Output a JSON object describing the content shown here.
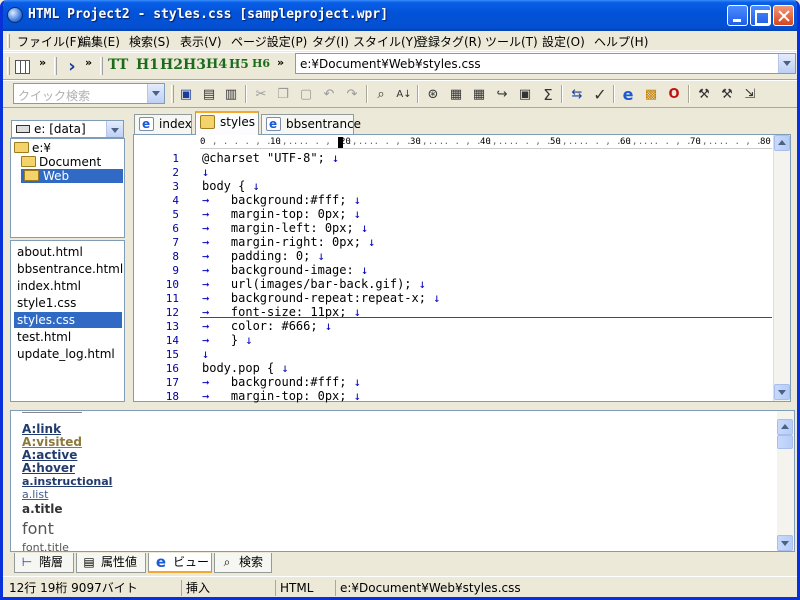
{
  "window": {
    "title": "HTML Project2 - styles.css [sampleproject.wpr]"
  },
  "menu": [
    "ファイル(F)",
    "編集(E)",
    "検索(S)",
    "表示(V)",
    "ページ設定(P)",
    "タグ(I)",
    "スタイル(Y)",
    "登録タグ(R)",
    "ツール(T)",
    "設定(O)",
    "ヘルプ(H)"
  ],
  "toolbar": {
    "headings": [
      "TT",
      "H1",
      "H2",
      "H3",
      "H4",
      "H5",
      "H6"
    ],
    "path": "e:¥Document¥Web¥styles.css",
    "quick_search_placeholder": "クイック検索"
  },
  "sidebar": {
    "drive": "e: [data]",
    "tree": [
      "e:¥",
      "Document",
      "Web"
    ],
    "files": [
      "about.html",
      "bbsentrance.html",
      "index.html",
      "style1.css",
      "styles.css",
      "test.html",
      "update_log.html"
    ],
    "selected_file": "styles.css"
  },
  "tabs": [
    "index",
    "styles",
    "bbsentrance"
  ],
  "editor": {
    "ruler": [
      "0",
      "10",
      "20",
      "30",
      "40",
      "50",
      "60",
      "70",
      "80"
    ],
    "lines": [
      {
        "n": "1",
        "text": "@charset \"UTF-8\";"
      },
      {
        "n": "2",
        "text": ""
      },
      {
        "n": "3",
        "text": "body {"
      },
      {
        "n": "4",
        "text": "    background:#fff;"
      },
      {
        "n": "5",
        "text": "    margin-top: 0px;"
      },
      {
        "n": "6",
        "text": "    margin-left: 0px;"
      },
      {
        "n": "7",
        "text": "    margin-right: 0px;"
      },
      {
        "n": "8",
        "text": "    padding: 0;"
      },
      {
        "n": "9",
        "text": "    background-image:"
      },
      {
        "n": "10",
        "text": "    url(images/bar-back.gif);"
      },
      {
        "n": "11",
        "text": "    background-repeat:repeat-x;"
      },
      {
        "n": "12",
        "text": "    font-size: 11px;"
      },
      {
        "n": "13",
        "text": "    color: #666;"
      },
      {
        "n": "14",
        "text": "    }"
      },
      {
        "n": "15",
        "text": ""
      },
      {
        "n": "16",
        "text": "body.pop {"
      },
      {
        "n": "17",
        "text": "    background:#fff;"
      },
      {
        "n": "18",
        "text": "    margin-top: 0px;"
      }
    ]
  },
  "preview": {
    "items": [
      "A:link",
      "A:visited",
      "A:active",
      "A:hover",
      "a.instructional",
      "a.list",
      "a.title",
      "font",
      "font.title"
    ]
  },
  "bottom_tabs": [
    "階層",
    "属性値",
    "ビュー",
    "検索"
  ],
  "status": {
    "position": "12行 19桁 9097バイト",
    "mode": "挿入",
    "type": "HTML",
    "path": "e:¥Document¥Web¥styles.css"
  },
  "colors": {
    "title_bar": "#0253d8",
    "selection": "#316ac5",
    "line_numbers": "#0000a0",
    "cursor_line": "#b02020"
  }
}
